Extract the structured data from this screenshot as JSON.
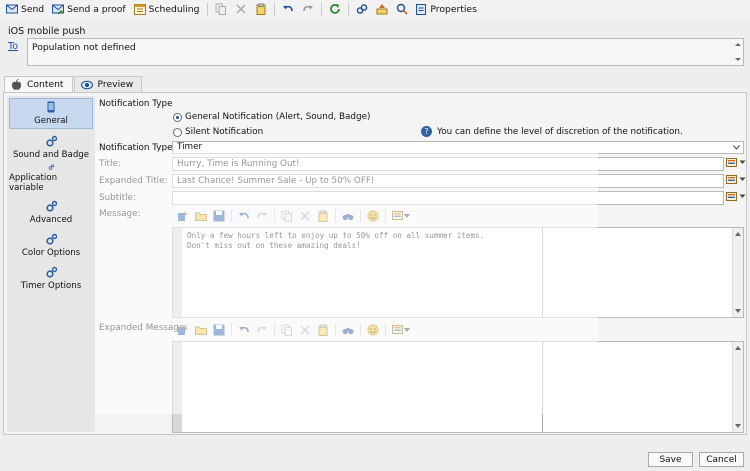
{
  "toolbar": {
    "send": "Send",
    "send_proof": "Send a proof",
    "scheduling": "Scheduling",
    "properties": "Properties"
  },
  "header": {
    "title": "iOS mobile push",
    "to_label": "To",
    "population": "Population not defined"
  },
  "tabs": [
    {
      "label": "Content",
      "icon": "apple-icon"
    },
    {
      "label": "Preview",
      "icon": "eye-icon"
    }
  ],
  "nav": [
    {
      "label": "General",
      "icon": "device-icon",
      "selected": true
    },
    {
      "label": "Sound and Badge",
      "icon": "gears-icon"
    },
    {
      "label": "Application variable",
      "icon": "gears-icon"
    },
    {
      "label": "Advanced",
      "icon": "gears-icon"
    },
    {
      "label": "Color Options",
      "icon": "gears-icon"
    },
    {
      "label": "Timer Options",
      "icon": "gears-icon"
    }
  ],
  "form": {
    "notification_type_heading": "Notification Type",
    "radio_general": "General Notification (Alert, Sound, Badge)",
    "radio_silent": "Silent Notification",
    "help_text": "You can define the level of discretion of the notification.",
    "notification_type_label": "Notification Type:",
    "notification_type_value": "Timer",
    "title_label": "Title:",
    "title_value": "Hurry, Time is Running Out!",
    "expanded_title_label": "Expanded Title:",
    "expanded_title_value": "Last Chance! Summer Sale - Up to 50% OFF!",
    "subtitle_label": "Subtitle:",
    "subtitle_value": "",
    "message_label": "Message:",
    "message_value": "Only a few hours left to enjoy up to 50% off on all summer items.\nDon't miss out on these amazing deals!",
    "expanded_message_label": "Expanded Message:",
    "expanded_message_value": ""
  },
  "footer": {
    "save": "Save",
    "cancel": "Cancel"
  },
  "colors": {
    "accent": "#1d4f91",
    "nav_selected": "#c7d9ee"
  }
}
